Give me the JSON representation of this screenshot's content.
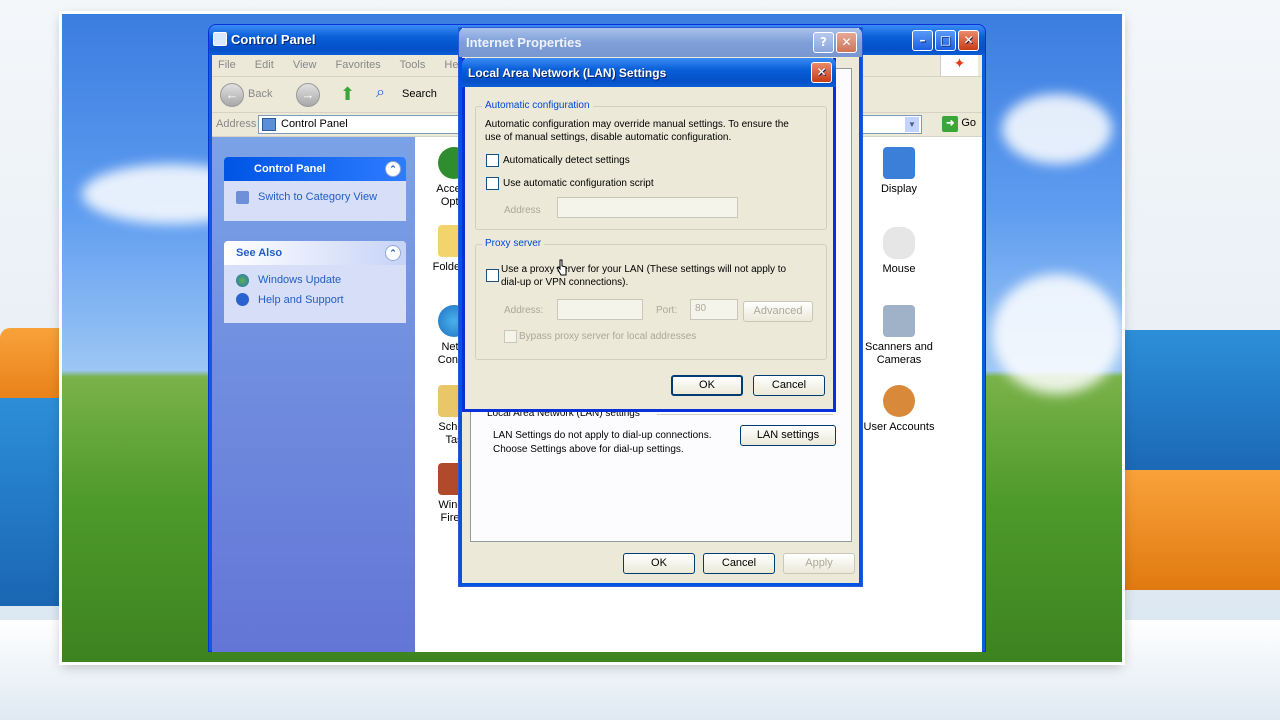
{
  "control_panel": {
    "title": "Control Panel",
    "menu": [
      "File",
      "Edit",
      "View",
      "Favorites",
      "Tools",
      "Help"
    ],
    "toolbar": {
      "back": "Back",
      "search": "Search"
    },
    "address_label": "Address",
    "address_value": "Control Panel",
    "go": "Go",
    "sidebar": {
      "panel_title": "Control Panel",
      "switch_view": "Switch to Category View",
      "see_also_title": "See Also",
      "see_also_items": [
        "Windows Update",
        "Help and Support"
      ]
    },
    "items_left": [
      {
        "line1": "Access",
        "line2": "Optio"
      },
      {
        "line1": "Folder O",
        "line2": ""
      },
      {
        "line1": "Netw",
        "line2": "Conne"
      },
      {
        "line1": "Sched",
        "line2": "Tas"
      },
      {
        "line1": "Windo",
        "line2": "Firew"
      }
    ],
    "items_right": [
      {
        "line1": "Display",
        "line2": ""
      },
      {
        "line1": "Mouse",
        "line2": ""
      },
      {
        "line1": "Scanners and",
        "line2": "Cameras"
      },
      {
        "line1": "User Accounts",
        "line2": ""
      }
    ]
  },
  "internet_properties": {
    "title": "Internet Properties",
    "lan_section_label": "Local Area Network (LAN) settings",
    "lan_section_text1": "LAN Settings do not apply to dial-up connections.",
    "lan_section_text2": "Choose Settings above for dial-up settings.",
    "lan_button": "LAN settings",
    "ok": "OK",
    "cancel": "Cancel",
    "apply": "Apply"
  },
  "lan_dialog": {
    "title": "Local Area Network (LAN) Settings",
    "auto_group": "Automatic configuration",
    "auto_text1": "Automatic configuration may override manual settings.  To ensure the",
    "auto_text2": "use of manual settings, disable automatic configuration.",
    "auto_detect": "Automatically detect settings",
    "use_script": "Use automatic configuration script",
    "address_label": "Address",
    "proxy_group": "Proxy server",
    "use_proxy1": "Use a proxy server for your LAN (These settings will not apply to",
    "use_proxy2": "dial-up or VPN connections).",
    "proxy_address_label": "Address:",
    "port_label": "Port:",
    "port_value": "80",
    "advanced": "Advanced",
    "bypass": "Bypass proxy server for local addresses",
    "ok": "OK",
    "cancel": "Cancel"
  }
}
